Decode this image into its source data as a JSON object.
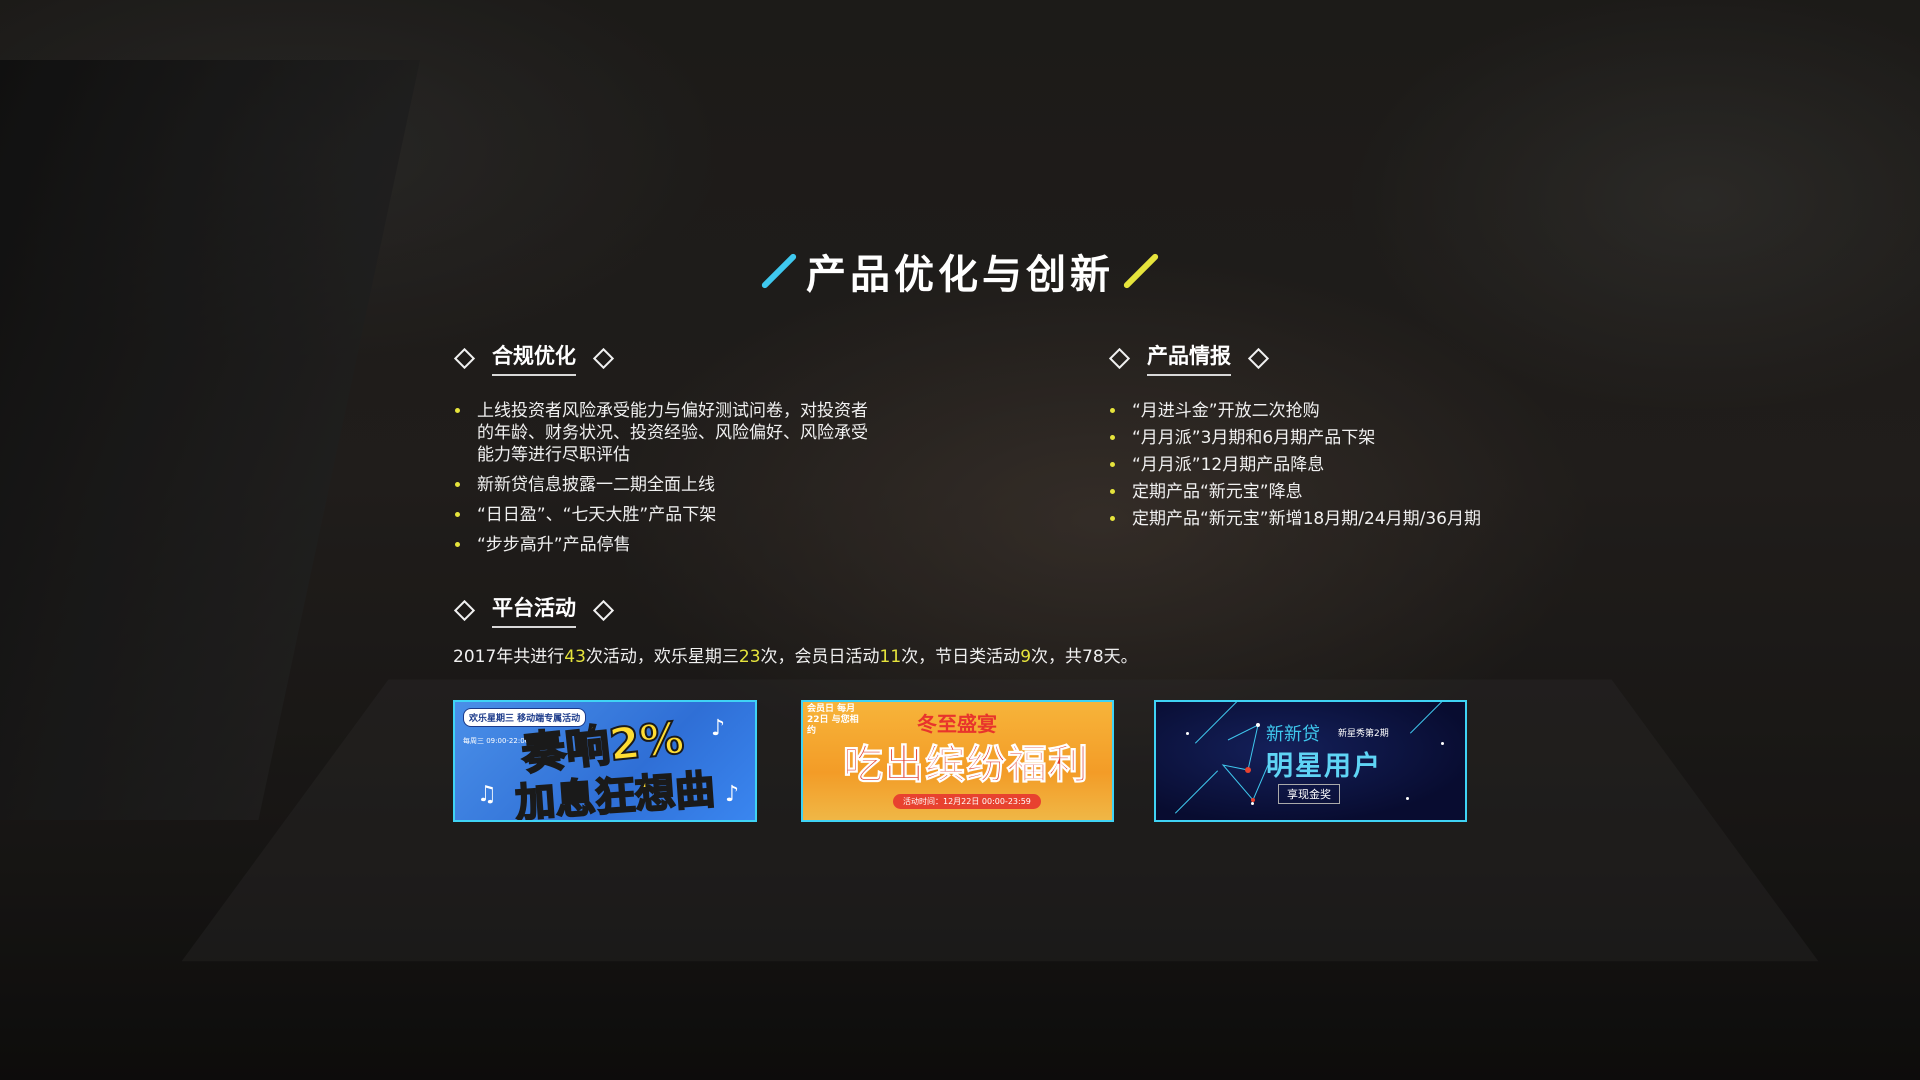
{
  "title": "产品优化与创新",
  "colors": {
    "accent_cyan": "#3fc8ee",
    "accent_yellow": "#e6e43c"
  },
  "compliance": {
    "heading": "合规优化",
    "items": [
      "上线投资者风险承受能力与偏好测试问卷，对投资者的年龄、财务状况、投资经验、风险偏好、风险承受能力等进行尽职评估",
      "新新贷信息披露一二期全面上线",
      "“日日盈”、“七天大胜”产品下架",
      "“步步高升”产品停售"
    ]
  },
  "product_info": {
    "heading": "产品情报",
    "items": [
      "“月进斗金”开放二次抢购",
      "“月月派”3月期和6月期产品下架",
      "“月月派”12月期产品降息",
      "定期产品“新元宝”降息",
      "定期产品“新元宝”新增18月期/24月期/36月期"
    ]
  },
  "platform": {
    "heading": "平台活动",
    "stats": {
      "p1": "2017年共进行",
      "n1": "43",
      "p2": "次活动，欢乐星期三",
      "n2": "23",
      "p3": "次，会员日活动",
      "n3": "11",
      "p4": "次，节日类活动",
      "n4": "9",
      "p5": "次，共78天。"
    }
  },
  "banners": {
    "b1": {
      "tag": "欢乐星期三 移动端专属活动",
      "time": "每周三 09:00-22:00",
      "line1": "奏响2%",
      "line2": "加息狂想曲"
    },
    "b2": {
      "corner": "会员日 每月22日 与您相约",
      "sub": "冬至盛宴",
      "big": "吃出缤纷福利",
      "pill": "活动时间：12月22日 00:00-23:59"
    },
    "b3": {
      "brand": "新新贷",
      "brand_sub": "新星秀第2期",
      "big": "明星用户",
      "btn": "享现金奖"
    }
  }
}
